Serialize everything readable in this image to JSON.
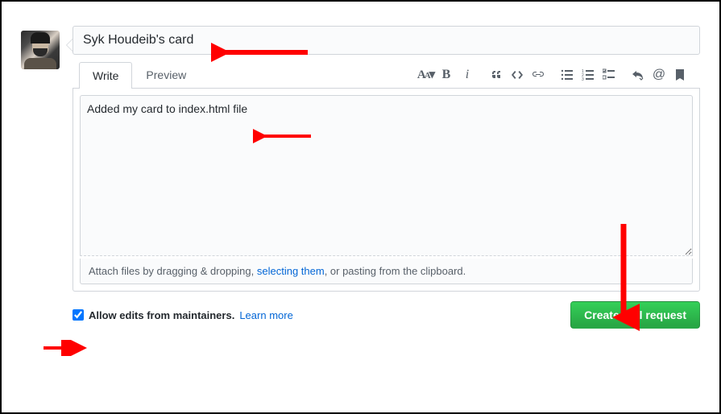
{
  "title_input": {
    "value": "Syk Houdeib's card"
  },
  "tabs": {
    "write": "Write",
    "preview": "Preview"
  },
  "comment_body": {
    "value": "Added my card to index.html file"
  },
  "attach_hint": {
    "pre": "Attach files by dragging & dropping, ",
    "link": "selecting them",
    "post": ", or pasting from the clipboard."
  },
  "allow_edits": {
    "checked": true,
    "label": "Allow edits from maintainers.",
    "learn_more": "Learn more"
  },
  "submit_button": {
    "label": "Create pull request"
  },
  "colors": {
    "primary_green": "#28a745",
    "link_blue": "#0366d6",
    "annotation_red": "#ff0000"
  }
}
